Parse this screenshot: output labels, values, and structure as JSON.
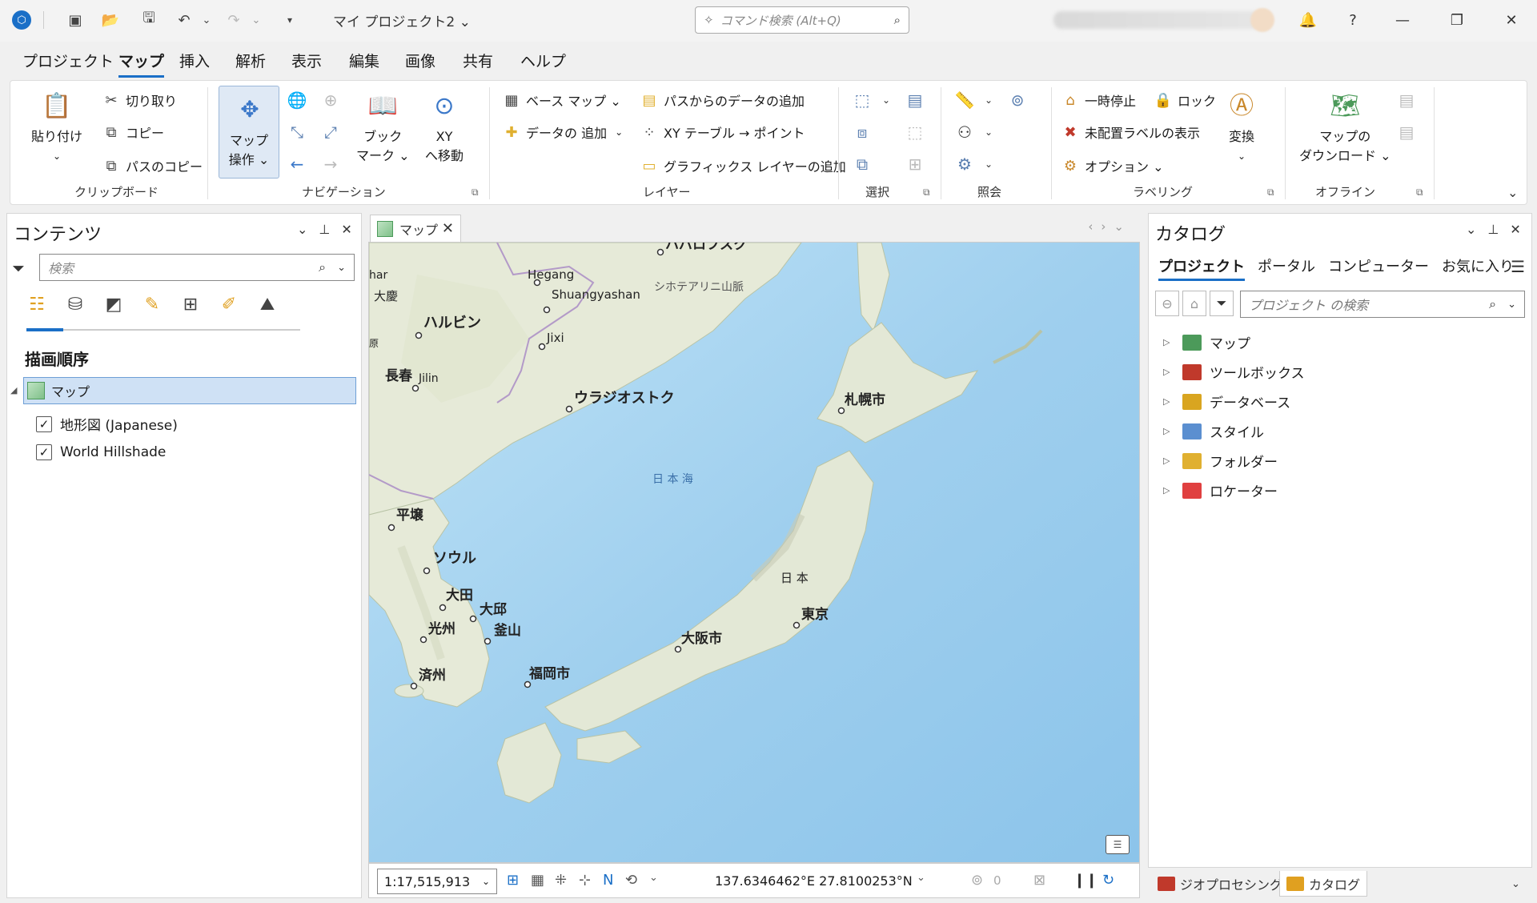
{
  "titlebar": {
    "project_title": "マイ プロジェクト2 ⌄",
    "command_search_placeholder": "コマンド検索 (Alt+Q)"
  },
  "menu": {
    "tabs": [
      "プロジェクト",
      "マップ",
      "挿入",
      "解析",
      "表示",
      "編集",
      "画像",
      "共有",
      "ヘルプ"
    ],
    "active": "マップ"
  },
  "ribbon": {
    "clipboard": {
      "paste": "貼り付け",
      "cut": "切り取り",
      "copy": "コピー",
      "copy_path": "パスのコピー",
      "label": "クリップボード"
    },
    "navigation": {
      "explore_1": "マップ",
      "explore_2": "操作 ⌄",
      "bookmark_1": "ブック",
      "bookmark_2": "マーク ⌄",
      "goto_1": "XY",
      "goto_2": "へ移動",
      "label": "ナビゲーション"
    },
    "layer": {
      "basemap": "ベース マップ ⌄",
      "add_data": "データの 追加",
      "add_from_path": "パスからのデータの追加",
      "xy_table": "XY テーブル → ポイント",
      "graphics_layer": "グラフィックス レイヤーの追加",
      "label": "レイヤー"
    },
    "selection": {
      "label": "選択"
    },
    "inquiry": {
      "label": "照会"
    },
    "labeling": {
      "pause": "一時停止",
      "lock": "ロック",
      "unplaced": "未配置ラベルの表示",
      "options": "オプション ⌄",
      "convert": "変換",
      "label": "ラベリング"
    },
    "offline": {
      "download_1": "マップの",
      "download_2": "ダウンロード ⌄",
      "label": "オフライン"
    }
  },
  "contents": {
    "title": "コンテンツ",
    "search_placeholder": "検索",
    "draw_order": "描画順序",
    "map_name": "マップ",
    "layers": [
      {
        "name": "地形図 (Japanese)",
        "checked": true
      },
      {
        "name": "World Hillshade",
        "checked": true
      }
    ]
  },
  "map_view": {
    "tab_label": "マップ",
    "scale": "1:17,515,913",
    "coordinates": "137.6346462°E 27.8100253°N",
    "label_count": "0",
    "labels": {
      "harbin": "ハルビン",
      "changchun": "長春",
      "jilin": "Jilin",
      "hegang": "Hegang",
      "shuangyashan": "Shuangyashan",
      "jixi": "Jixi",
      "vladivostok": "ウラジオストク",
      "sikhote": "シホテアリニ山脈",
      "sea_of_japan": "日 本 海",
      "sapporo": "札幌市",
      "pyongyang": "平壌",
      "seoul": "ソウル",
      "daejeon": "大田",
      "daegu": "大邱",
      "gwangju": "光州",
      "busan": "釜山",
      "jeju": "済州",
      "fukuoka": "福岡市",
      "osaka": "大阪市",
      "tokyo": "東京",
      "japan": "日 本",
      "khabarovsk": "ハバロフスク",
      "daqing": "大慶",
      "har": "har",
      "edge": "原"
    }
  },
  "catalog": {
    "title": "カタログ",
    "tabs": [
      "プロジェクト",
      "ポータル",
      "コンピューター",
      "お気に入り"
    ],
    "search_placeholder": "プロジェクト の検索",
    "items": [
      {
        "name": "マップ",
        "color": "#4c9a5a"
      },
      {
        "name": "ツールボックス",
        "color": "#c0392b"
      },
      {
        "name": "データベース",
        "color": "#d9a520"
      },
      {
        "name": "スタイル",
        "color": "#5b8fd0"
      },
      {
        "name": "フォルダー",
        "color": "#e0b030"
      },
      {
        "name": "ロケーター",
        "color": "#e04040"
      }
    ]
  },
  "bottom_tabs": {
    "geoprocessing": "ジオプロセシング",
    "catalog": "カタログ"
  }
}
